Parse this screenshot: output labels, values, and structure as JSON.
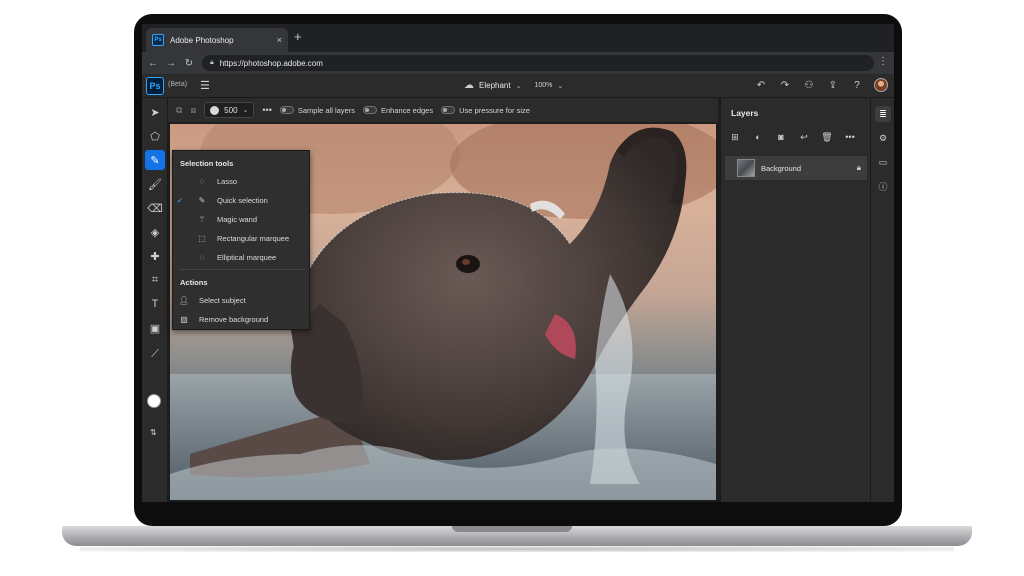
{
  "browser": {
    "tab_title": "Adobe Photoshop",
    "tab_close": "×",
    "new_tab": "+",
    "url": "https://photoshop.adobe.com",
    "nav": {
      "back": "←",
      "forward": "→",
      "reload": "↻"
    },
    "menu": "⋮"
  },
  "app": {
    "logo": "Ps",
    "beta_label": "(Beta)",
    "document_name": "Elephant",
    "zoom": "100%",
    "menu_icon": "☰"
  },
  "options_bar": {
    "brush_size": "500",
    "toggles": [
      {
        "label": "Sample all layers"
      },
      {
        "label": "Enhance edges"
      },
      {
        "label": "Use pressure for size"
      }
    ]
  },
  "flyout": {
    "selection_header": "Selection tools",
    "selection_items": [
      {
        "label": "Lasso",
        "checked": false,
        "icon": "lasso-icon"
      },
      {
        "label": "Quick selection",
        "checked": true,
        "icon": "quick-selection-icon"
      },
      {
        "label": "Magic wand",
        "checked": false,
        "icon": "magic-wand-icon"
      },
      {
        "label": "Rectangular marquee",
        "checked": false,
        "icon": "rectangular-marquee-icon"
      },
      {
        "label": "Elliptical marquee",
        "checked": false,
        "icon": "elliptical-marquee-icon"
      }
    ],
    "actions_header": "Actions",
    "action_items": [
      {
        "label": "Select subject",
        "icon": "person-icon"
      },
      {
        "label": "Remove background",
        "icon": "image-icon"
      }
    ]
  },
  "layers": {
    "title": "Layers",
    "items": [
      {
        "name": "Background",
        "locked": true
      }
    ]
  },
  "colors": {
    "accent": "#1473e6",
    "ps_blue": "#31a8ff",
    "foreground_swatch": "#ffffff",
    "background_swatch": "#000000"
  }
}
